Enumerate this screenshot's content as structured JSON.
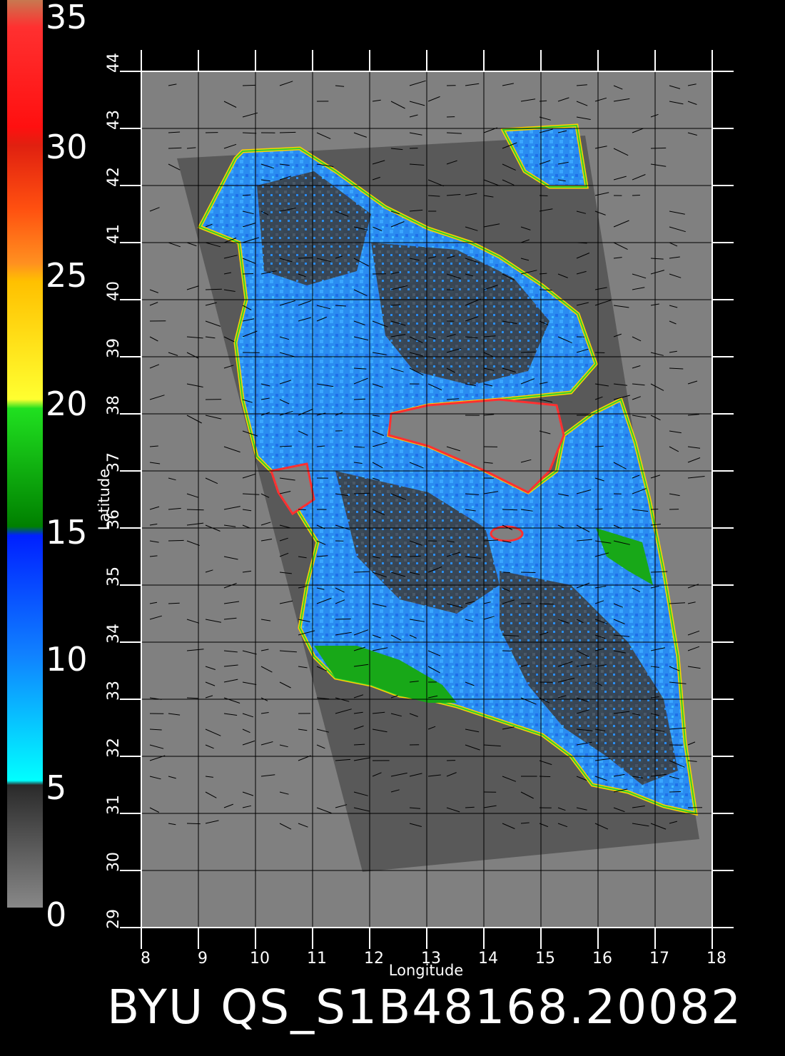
{
  "map": {
    "lon_range": [
      8,
      18
    ],
    "lat_range": [
      29,
      44
    ],
    "lon_ticks": [
      "8",
      "9",
      "10",
      "11",
      "12",
      "13",
      "14",
      "15",
      "16",
      "17",
      "18"
    ],
    "lat_ticks": [
      "29",
      "30",
      "31",
      "32",
      "33",
      "34",
      "35",
      "36",
      "37",
      "38",
      "39",
      "40",
      "41",
      "42",
      "43",
      "44"
    ],
    "xlabel": "Longitude",
    "ylabel": "Latitude",
    "background_color": "#808080",
    "swath_color": "#595959",
    "land_color": "#808080"
  },
  "colorbar": {
    "labels": [
      "35",
      "30",
      "25",
      "20",
      "15",
      "10",
      "5",
      "0"
    ],
    "range": [
      0,
      35
    ]
  },
  "footer": {
    "title": "BYU  QS_S1B48168.20082"
  }
}
